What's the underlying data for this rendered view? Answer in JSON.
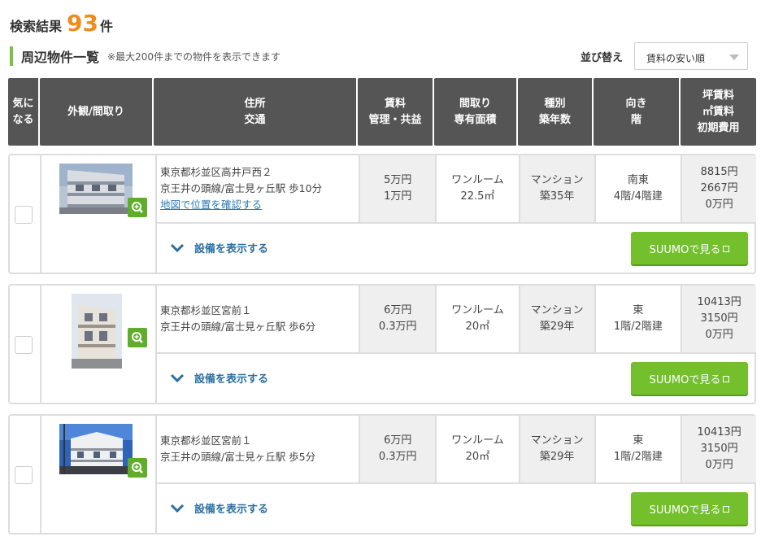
{
  "summary": {
    "label": "検索結果",
    "count": "93",
    "unit": "件"
  },
  "section": {
    "title": "周辺物件一覧",
    "note": "※最大200件までの物件を表示できます"
  },
  "sort": {
    "label": "並び替え",
    "value": "賃料の安い順"
  },
  "headers": [
    [
      "気に",
      "なる"
    ],
    [
      "外観/間取り"
    ],
    [
      "住所",
      "交通"
    ],
    [
      "賃料",
      "管理・共益"
    ],
    [
      "間取り",
      "専有面積"
    ],
    [
      "種別",
      "築年数"
    ],
    [
      "向き",
      "階"
    ],
    [
      "坪賃料",
      "㎡賃料",
      "初期費用"
    ]
  ],
  "listings": [
    {
      "address": "東京都杉並区高井戸西２",
      "access": "京王井の頭線/富士見ヶ丘駅 歩10分",
      "map_link": "地図で位置を確認する",
      "rent": "5万円",
      "fee": "1万円",
      "layout": "ワンルーム",
      "area": "22.5㎡",
      "type": "マンション",
      "age": "築35年",
      "direction": "南東",
      "floor": "4階/4階建",
      "tsubo": "8815円",
      "sqm": "2667円",
      "initial": "0万円",
      "equip_label": "設備を表示する",
      "suumo_label": "SUUMOで見る"
    },
    {
      "address": "東京都杉並区宮前１",
      "access": "京王井の頭線/富士見ヶ丘駅 歩6分",
      "map_link": "",
      "rent": "6万円",
      "fee": "0.3万円",
      "layout": "ワンルーム",
      "area": "20㎡",
      "type": "マンション",
      "age": "築29年",
      "direction": "東",
      "floor": "1階/2階建",
      "tsubo": "10413円",
      "sqm": "3150円",
      "initial": "0万円",
      "equip_label": "設備を表示する",
      "suumo_label": "SUUMOで見る"
    },
    {
      "address": "東京都杉並区宮前１",
      "access": "京王井の頭線/富士見ヶ丘駅 歩5分",
      "map_link": "",
      "rent": "6万円",
      "fee": "0.3万円",
      "layout": "ワンルーム",
      "area": "20㎡",
      "type": "マンション",
      "age": "築29年",
      "direction": "東",
      "floor": "1階/2階建",
      "tsubo": "10413円",
      "sqm": "3150円",
      "initial": "0万円",
      "equip_label": "設備を表示する",
      "suumo_label": "SUUMOで見る"
    }
  ],
  "colors": {
    "accent": "#f08c1e",
    "green": "#74bf2c",
    "header": "#555555",
    "link": "#2a7ab8"
  }
}
